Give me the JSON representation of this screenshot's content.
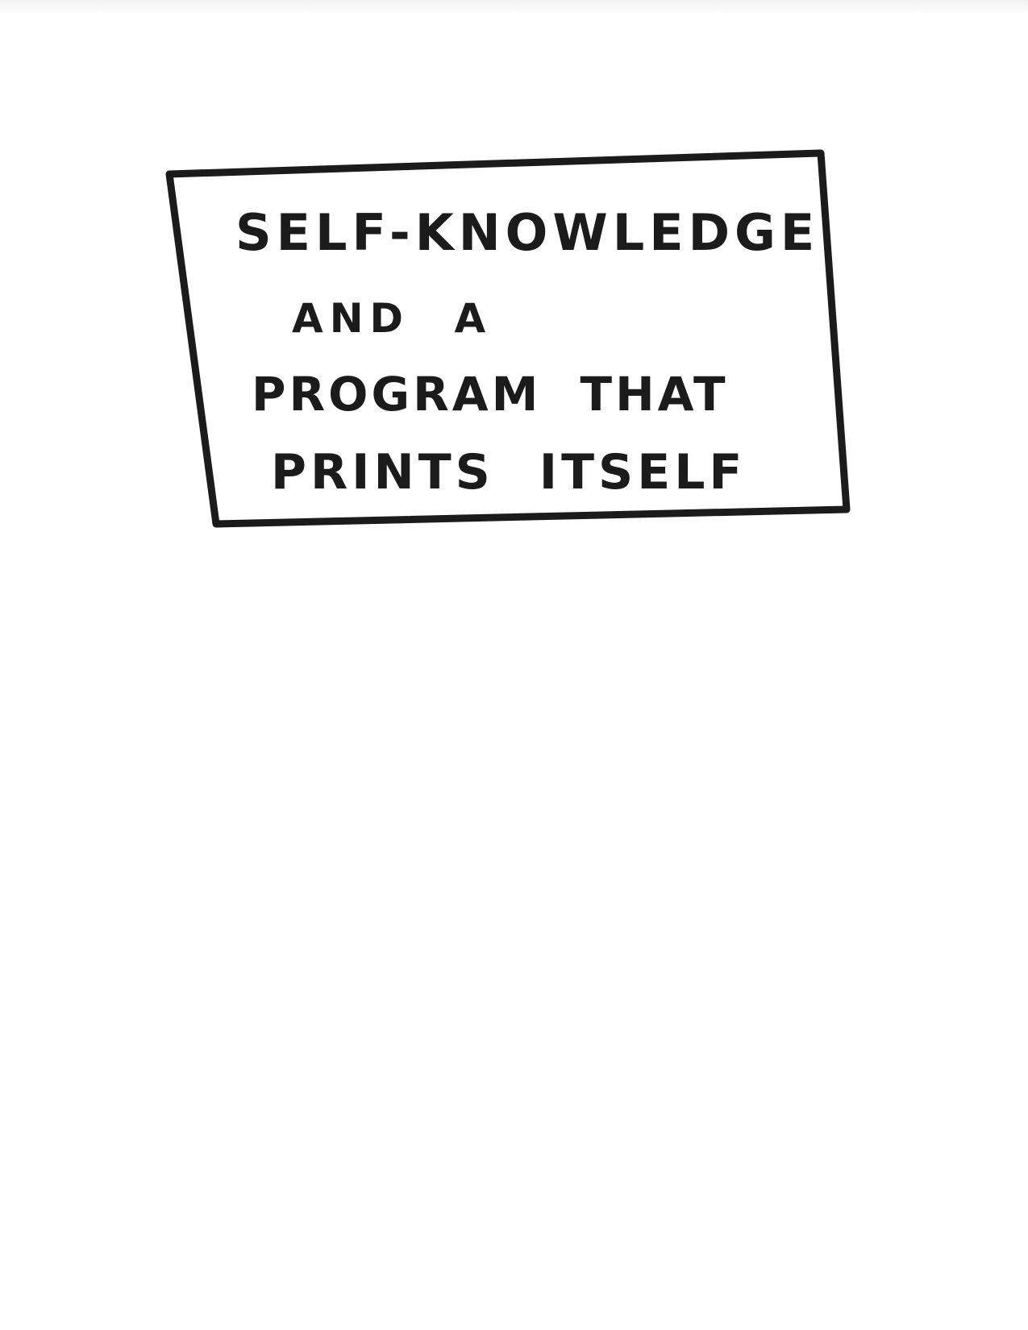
{
  "document": {
    "title_lines": [
      "SELF-KNOWLEDGE",
      "AND A",
      "PROGRAM THAT",
      "PRINTS ITSELF"
    ]
  },
  "colors": {
    "ink": "#1b1b1b",
    "paper": "#fefefe"
  }
}
